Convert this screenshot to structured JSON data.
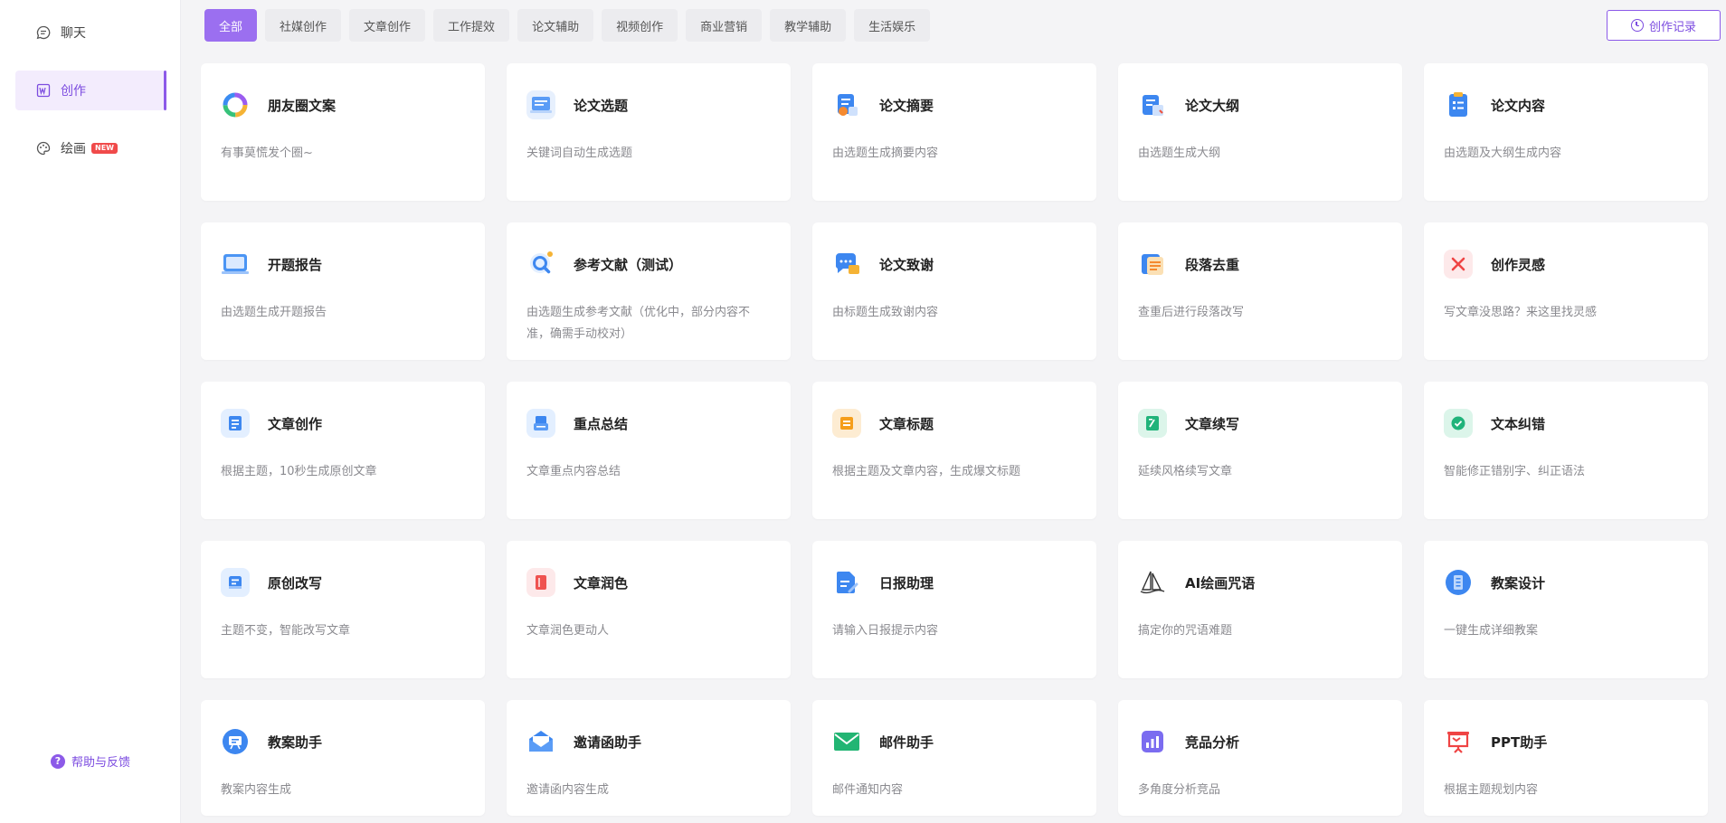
{
  "sidebar": {
    "items": [
      {
        "label": "聊天",
        "icon": "chat-icon"
      },
      {
        "label": "创作",
        "icon": "document-w-icon",
        "active": true
      },
      {
        "label": "绘画",
        "icon": "palette-icon",
        "badge": "NEW"
      }
    ],
    "help_label": "帮助与反馈"
  },
  "tabs": [
    "全部",
    "社媒创作",
    "文章创作",
    "工作提效",
    "论文辅助",
    "视频创作",
    "商业营销",
    "教学辅助",
    "生活娱乐"
  ],
  "history_label": "创作记录",
  "colors": {
    "accent": "#8c5ae8",
    "active_tab": "#9b6ff0"
  },
  "cards": [
    {
      "title": "朋友圈文案",
      "desc": "有事莫慌发个圈~",
      "icon": "ring-icon"
    },
    {
      "title": "论文选题",
      "desc": "关键词自动生成选题",
      "icon": "paper-topic-icon"
    },
    {
      "title": "论文摘要",
      "desc": "由选题生成摘要内容",
      "icon": "paper-abstract-icon"
    },
    {
      "title": "论文大纲",
      "desc": "由选题生成大纲",
      "icon": "paper-outline-icon"
    },
    {
      "title": "论文内容",
      "desc": "由选题及大纲生成内容",
      "icon": "paper-content-icon"
    },
    {
      "title": "开题报告",
      "desc": "由选题生成开题报告",
      "icon": "report-icon"
    },
    {
      "title": "参考文献（测试）",
      "desc": "由选题生成参考文献（优化中，部分内容不准，确需手动校对）",
      "icon": "reference-icon"
    },
    {
      "title": "论文致谢",
      "desc": "由标题生成致谢内容",
      "icon": "thanks-icon"
    },
    {
      "title": "段落去重",
      "desc": "查重后进行段落改写",
      "icon": "dedupe-icon"
    },
    {
      "title": "创作灵感",
      "desc": "写文章没思路？来这里找灵感",
      "icon": "inspiration-icon"
    },
    {
      "title": "文章创作",
      "desc": "根据主题，10秒生成原创文章",
      "icon": "article-icon"
    },
    {
      "title": "重点总结",
      "desc": "文章重点内容总结",
      "icon": "summary-icon"
    },
    {
      "title": "文章标题",
      "desc": "根据主题及文章内容，生成爆文标题",
      "icon": "headline-icon"
    },
    {
      "title": "文章续写",
      "desc": "延续风格续写文章",
      "icon": "continue-icon"
    },
    {
      "title": "文本纠错",
      "desc": "智能修正错别字、纠正语法",
      "icon": "correction-icon"
    },
    {
      "title": "原创改写",
      "desc": "主题不变，智能改写文章",
      "icon": "rewrite-icon"
    },
    {
      "title": "文章润色",
      "desc": "文章润色更动人",
      "icon": "polish-icon"
    },
    {
      "title": "日报助理",
      "desc": "请输入日报提示内容",
      "icon": "daily-report-icon"
    },
    {
      "title": "AI绘画咒语",
      "desc": "搞定你的咒语难题",
      "icon": "sailboat-icon"
    },
    {
      "title": "教案设计",
      "desc": "一键生成详细教案",
      "icon": "lesson-design-icon"
    },
    {
      "title": "教案助手",
      "desc": "教案内容生成",
      "icon": "lesson-assistant-icon"
    },
    {
      "title": "邀请函助手",
      "desc": "邀请函内容生成",
      "icon": "invitation-icon"
    },
    {
      "title": "邮件助手",
      "desc": "邮件通知内容",
      "icon": "mail-icon"
    },
    {
      "title": "竞品分析",
      "desc": "多角度分析竞品",
      "icon": "chart-icon"
    },
    {
      "title": "PPT助手",
      "desc": "根据主题规划内容",
      "icon": "ppt-icon"
    }
  ]
}
